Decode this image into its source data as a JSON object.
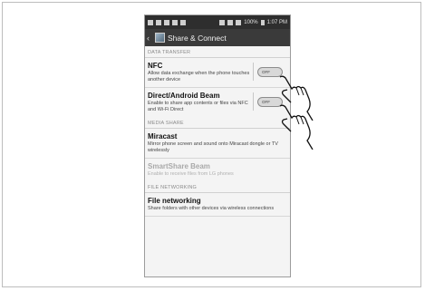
{
  "status_bar": {
    "battery": "100%",
    "time": "1:07 PM"
  },
  "action_bar": {
    "title": "Share & Connect"
  },
  "sections": [
    {
      "header": "DATA TRANSFER"
    },
    {
      "header": "MEDIA SHARE"
    },
    {
      "header": "FILE NETWORKING"
    }
  ],
  "items": {
    "nfc": {
      "title": "NFC",
      "desc": "Allow data exchange when the phone touches another device",
      "toggle": "OFF"
    },
    "beam": {
      "title": "Direct/Android Beam",
      "desc": "Enable to share app contents or files via NFC and Wi-Fi Direct",
      "toggle": "OFF"
    },
    "miracast": {
      "title": "Miracast",
      "desc": "Mirror phone screen and sound onto Miracast dongle or TV wirelessly"
    },
    "smartshare": {
      "title": "SmartShare Beam",
      "desc": "Enable to receive files from LG phones"
    },
    "filenet": {
      "title": "File networking",
      "desc": "Share folders with other devices via wireless connections"
    }
  },
  "icons": [
    "back-icon",
    "settings-app-icon",
    "hand-pointer-icon"
  ]
}
